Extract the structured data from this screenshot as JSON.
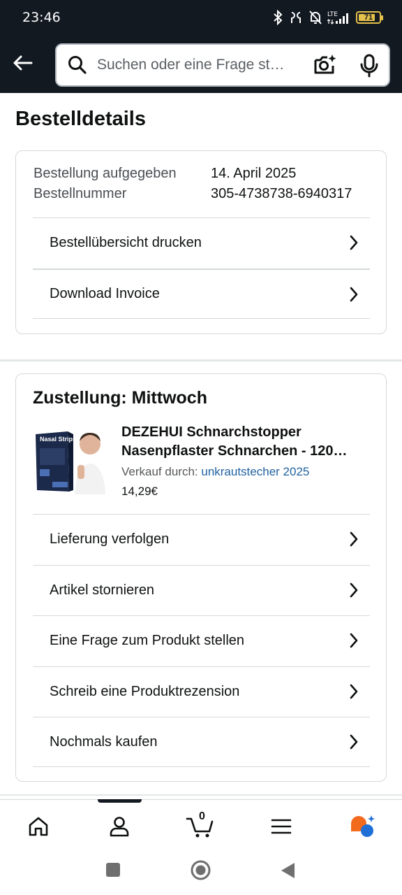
{
  "status_bar": {
    "time": "23:46",
    "battery": "71",
    "network": "LTE"
  },
  "header": {
    "search_placeholder": "Suchen oder eine Frage st…"
  },
  "page_title": "Bestelldetails",
  "order": {
    "placed_label": "Bestellung aufgegeben",
    "placed_value": "14. April 2025",
    "number_label": "Bestellnummer",
    "number_value": "305-4738738-6940317",
    "actions": [
      {
        "label": "Bestellübersicht drucken"
      },
      {
        "label": "Download Invoice"
      }
    ]
  },
  "delivery": {
    "title": "Zustellung: Mittwoch",
    "product": {
      "title_line1": "DEZEHUI Schnarchstopper",
      "title_line2": "Nasenpflaster Schnarchen - 120…",
      "image_text": "Nasal Strips",
      "seller_label": "Verkauf durch:",
      "seller_name": "unkrautstecher 2025",
      "price": "14,29€"
    },
    "actions": [
      {
        "label": "Lieferung verfolgen"
      },
      {
        "label": "Artikel stornieren"
      },
      {
        "label": "Eine Frage zum Produkt stellen"
      },
      {
        "label": "Schreib eine Produktrezension"
      },
      {
        "label": "Nochmals kaufen"
      }
    ]
  },
  "bottom_nav": {
    "items": [
      "home-icon",
      "account-icon",
      "cart-icon",
      "menu-icon",
      "rufus-icon"
    ],
    "cart_count": "0",
    "active": "account-icon"
  },
  "colors": {
    "header_bg": "#131921",
    "link": "#2162a1",
    "border": "#d5d9d9"
  }
}
